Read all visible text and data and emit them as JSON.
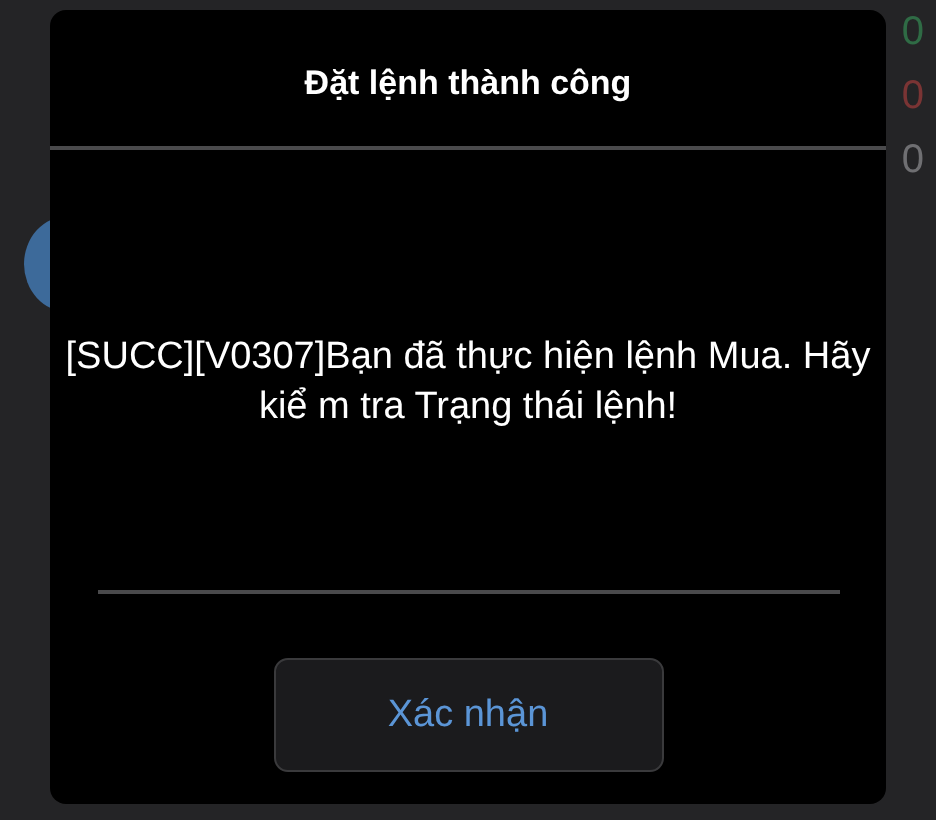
{
  "background": {
    "right_values": [
      {
        "text": "0",
        "color": "#2f6b45"
      },
      {
        "text": "0",
        "color": "#7a3434"
      },
      {
        "text": "0",
        "color": "#6f6f72"
      }
    ]
  },
  "dialog": {
    "title": "Đặt lệnh thành công",
    "message": "[SUCC][V0307]Bạn đã thực hiện lệnh Mua. Hãy kiể m tra Trạng thái lệnh!",
    "button": "Xác nhận"
  }
}
